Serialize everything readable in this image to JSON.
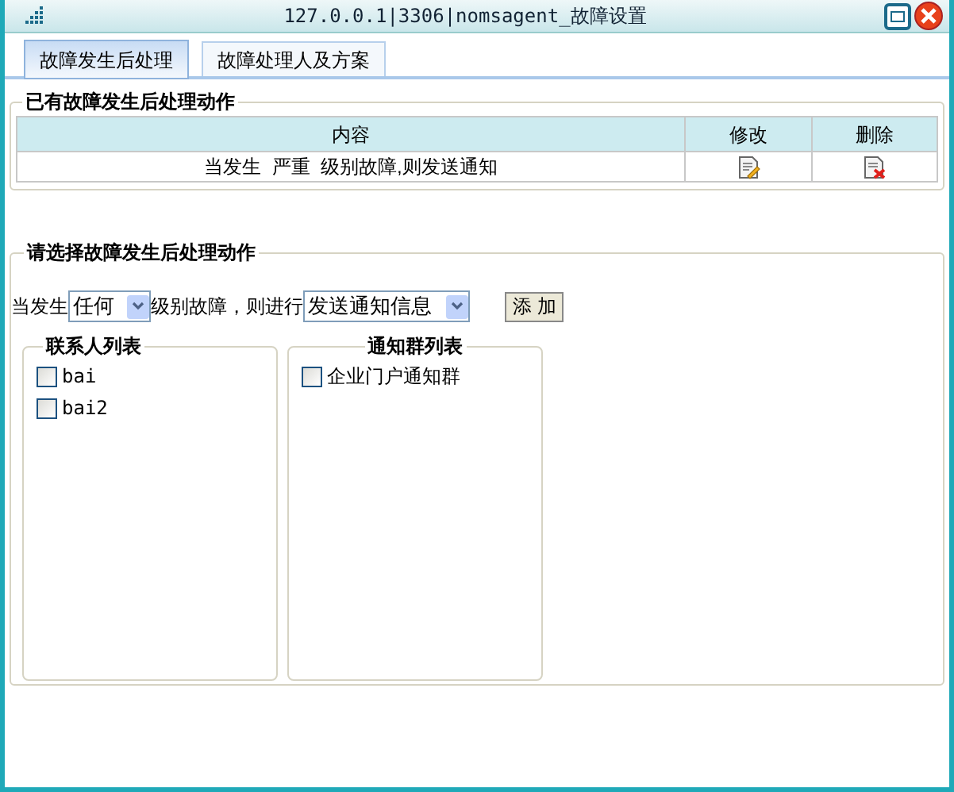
{
  "window": {
    "title": "127.0.0.1|3306|nomsagent_故障设置"
  },
  "tabs": [
    {
      "label": "故障发生后处理",
      "selected": true
    },
    {
      "label": "故障处理人及方案",
      "selected": false
    }
  ],
  "existing_actions": {
    "legend": "已有故障发生后处理动作",
    "columns": [
      "内容",
      "修改",
      "删除"
    ],
    "rows": [
      {
        "content": "当发生  严重  级别故障,则发送通知"
      }
    ]
  },
  "new_action": {
    "legend": "请选择故障发生后处理动作",
    "prefix": "当发生",
    "level_select": "任何",
    "middle": "级别故障，则进行",
    "action_select": "发送通知信息",
    "add_button": "添 加",
    "lists": [
      {
        "legend": "联系人列表",
        "items": [
          {
            "label": "bai",
            "checked": false
          },
          {
            "label": "bai2",
            "checked": false
          }
        ]
      },
      {
        "legend": "通知群列表",
        "items": [
          {
            "label": "企业门户通知群",
            "checked": false
          }
        ]
      }
    ]
  }
}
